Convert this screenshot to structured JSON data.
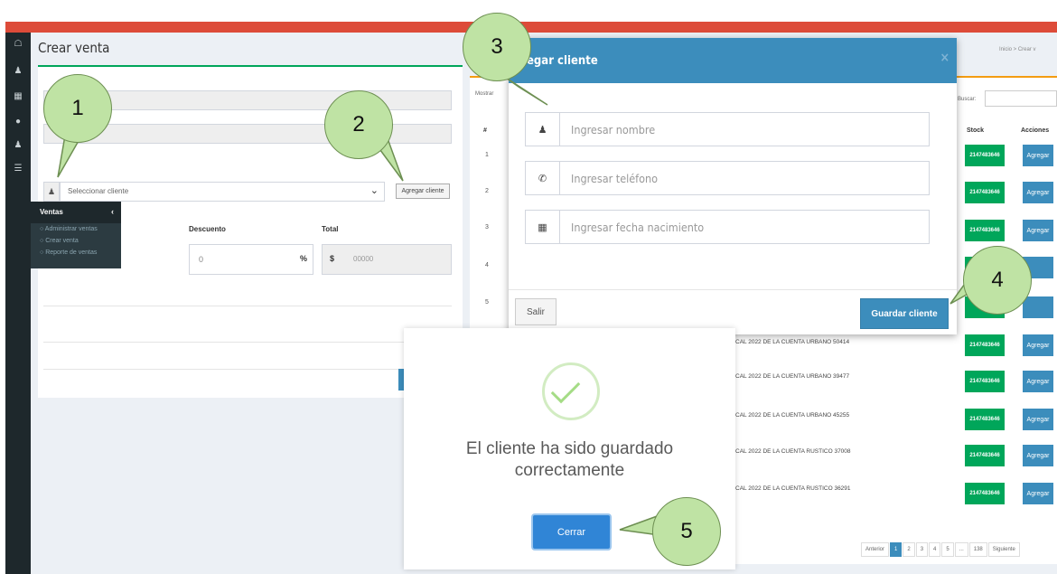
{
  "left_panel": {
    "page_title": "Crear venta",
    "select_placeholder": "Seleccionar cliente",
    "add_client_button": "Agregar cliente",
    "discount_label": "Descuento",
    "total_label": "Total",
    "discount_value": "0",
    "percent_sign": "%",
    "currency_sign": "$",
    "total_placeholder": "00000"
  },
  "menu": {
    "title": "Ventas",
    "items": [
      "Administrar ventas",
      "Crear venta",
      "Reporte de ventas"
    ]
  },
  "breadcrumb": "Inicio > Crear v",
  "right_table": {
    "show_label": "Mostrar",
    "search_label": "Buscar:",
    "headers": {
      "number": "#",
      "stock": "Stock",
      "actions": "Acciones"
    },
    "row_numbers": [
      "1",
      "2",
      "3",
      "4",
      "5"
    ],
    "rows": [
      {
        "text": "CAL 2022 DE LA CUENTA URBANO 50414",
        "stock": "2147483646",
        "action": "Agregar"
      },
      {
        "text": "CAL 2022 DE LA CUENTA URBANO 39477",
        "stock": "2147483646",
        "action": "Agregar"
      },
      {
        "text": "CAL 2022 DE LA CUENTA URBANO 45255",
        "stock": "2147483646",
        "action": "Agregar"
      },
      {
        "text": "CAL 2022 DE LA CUENTA RUSTICO 37008",
        "stock": "2147483646",
        "action": "Agregar"
      },
      {
        "text": "CAL 2022 DE LA CUENTA RUSTICO 36291",
        "stock": "2147483646",
        "action": "Agregar"
      }
    ],
    "top_rows": [
      {
        "stock": "2147483646",
        "action": "Agregar"
      },
      {
        "stock": "2147483646",
        "action": "Agregar"
      },
      {
        "stock": "2147483646",
        "action": "Agregar"
      }
    ],
    "pagination": [
      "Anterior",
      "1",
      "2",
      "3",
      "4",
      "5",
      "...",
      "138",
      "Siguiente"
    ]
  },
  "modal": {
    "title": "Agregar cliente",
    "title_visible": "egar cliente",
    "name_placeholder": "Ingresar nombre",
    "phone_placeholder": "Ingresar teléfono",
    "birthdate_placeholder": "Ingresar fecha nacimiento",
    "cancel_button": "Salir",
    "save_button": "Guardar cliente"
  },
  "alert": {
    "message_line1": "El cliente ha sido guardado",
    "message_line2": "correctamente",
    "close_button": "Cerrar",
    "success_color": "#a5dc86"
  },
  "callouts": [
    "1",
    "2",
    "3",
    "4",
    "5"
  ],
  "colors": {
    "topbar": "#dd4b39",
    "sidebar": "#1e282c",
    "primary": "#3c8dbc",
    "success": "#00a65a",
    "callout_fill": "#bfe3a4"
  }
}
